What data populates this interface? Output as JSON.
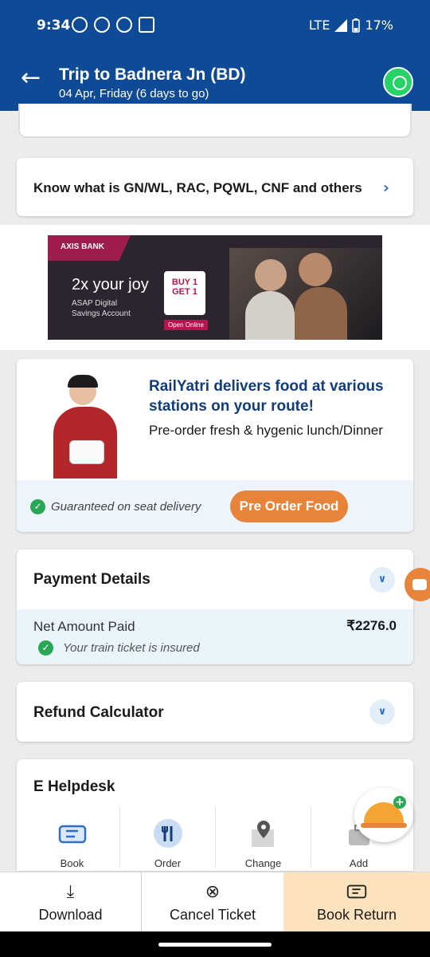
{
  "status_bar": {
    "time": "9:34",
    "network": "LTE",
    "battery": "17%"
  },
  "header": {
    "title": "Trip to Badnera Jn (BD)",
    "subtitle": "04 Apr, Friday (6 days to go)",
    "back_icon": "arrow-left-icon",
    "share_icon": "whatsapp-icon"
  },
  "info_card": {
    "text": "Know what is GN/WL, RAC, PQWL, CNF and others"
  },
  "ad": {
    "brand": "AXIS BANK",
    "headline": "2x your joy",
    "line": "ASAP Digital Savings Account",
    "offer": "BUY 1 GET 1",
    "cta": "Open Online"
  },
  "food_card": {
    "heading": "RailYatri delivers food at various stations on your route!",
    "description": "Pre-order fresh & hygenic lunch/Dinner",
    "guarantee": "Guaranteed on seat delivery",
    "button": "Pre Order Food"
  },
  "payment": {
    "title": "Payment Details",
    "net_label": "Net Amount Paid",
    "amount": "₹2276.0",
    "insured": "Your train ticket is insured"
  },
  "refund": {
    "title": "Refund Calculator"
  },
  "helpdesk": {
    "title": "E Helpdesk",
    "items": [
      {
        "label": "Book",
        "icon": "ticket-icon"
      },
      {
        "label": "Order",
        "icon": "fork-knife-icon"
      },
      {
        "label": "Change",
        "icon": "map-pin-icon"
      },
      {
        "label": "Add",
        "icon": "luggage-icon"
      }
    ]
  },
  "bottom_bar": {
    "download": "Download",
    "cancel": "Cancel Ticket",
    "book_return": "Book Return"
  },
  "colors": {
    "header_bg": "#0f4a96",
    "accent_orange": "#e8833a",
    "book_return_bg": "#fce3bd",
    "success_green": "#2aa756",
    "heading_blue": "#123d7a"
  }
}
